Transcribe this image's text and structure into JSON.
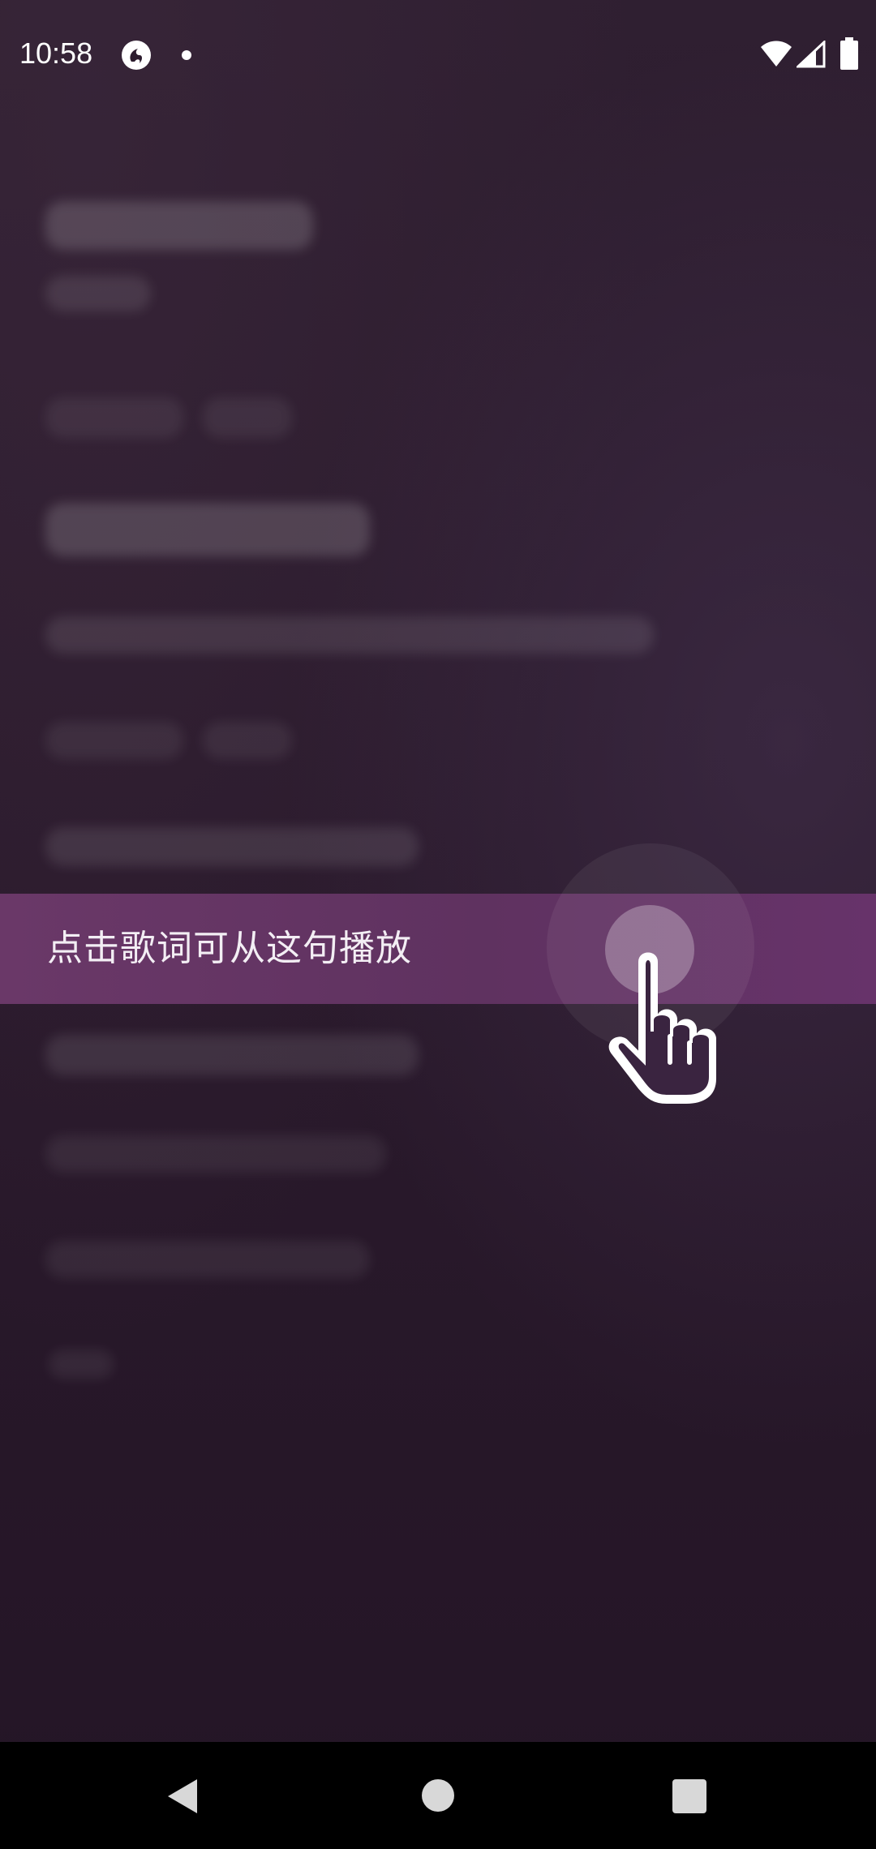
{
  "status_bar": {
    "time": "10:58",
    "icons": [
      "app-notification-icon",
      "dot-icon",
      "wifi-icon",
      "signal-icon",
      "battery-icon"
    ]
  },
  "hint": {
    "text": "点击歌词可从这句播放",
    "gesture_icon": "tap-hand-icon"
  },
  "nav_bar": {
    "icons": [
      "back-icon",
      "home-icon",
      "recents-icon"
    ]
  },
  "colors": {
    "background": "#2a1a2c",
    "hint_banner": "#643466",
    "nav_bar": "#000000",
    "text": "#f3eef4"
  }
}
